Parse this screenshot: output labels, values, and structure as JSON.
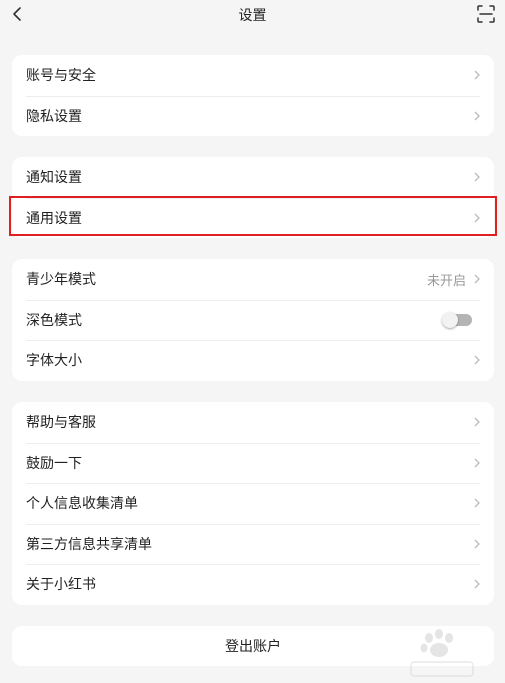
{
  "header": {
    "title": "设置",
    "back_icon": "chevron-left-icon",
    "scan_icon": "scan-icon"
  },
  "groups": [
    {
      "items": [
        {
          "label": "账号与安全"
        },
        {
          "label": "隐私设置"
        }
      ]
    },
    {
      "items": [
        {
          "label": "通知设置"
        },
        {
          "label": "通用设置"
        }
      ]
    },
    {
      "items": [
        {
          "label": "青少年模式",
          "value": "未开启"
        },
        {
          "label": "深色模式",
          "toggle": false
        },
        {
          "label": "字体大小"
        }
      ]
    },
    {
      "items": [
        {
          "label": "帮助与客服"
        },
        {
          "label": "鼓励一下"
        },
        {
          "label": "个人信息收集清单"
        },
        {
          "label": "第三方信息共享清单"
        },
        {
          "label": "关于小红书"
        }
      ]
    }
  ],
  "logout": {
    "label": "登出账户"
  },
  "highlight": {
    "color": "#e02020"
  }
}
